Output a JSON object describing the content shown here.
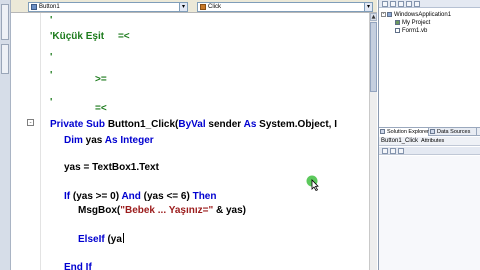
{
  "editor": {
    "class_combo": "Button1",
    "method_combo": "Click",
    "lines": {
      "comment1": "'",
      "comment2": "'Küçük Eşit     =<",
      "comment3": "'",
      "comment4a": "'",
      "comment4b": ">=",
      "comment5a": "'",
      "comment5b": "=<",
      "sub_decl": {
        "kw1": "Private Sub ",
        "name": "Button1_Click(",
        "kw2": "ByVal",
        "p1": " sender ",
        "kw3": "As",
        "p2": " System.Object, ",
        "tail": "I"
      },
      "dim": {
        "kw1": "Dim",
        "p1": " yas ",
        "kw2": "As Integer"
      },
      "assign": "yas = TextBox1.Text",
      "if": {
        "kw1": "If",
        "p1": " (yas >= 0) ",
        "kw2": "And",
        "p2": " (yas <= 6) ",
        "kw3": "Then"
      },
      "msgbox": {
        "p1": "MsgBox(",
        "str": "\"Bebek ... Yaşınız=\"",
        "p2": " & yas)"
      },
      "elseif": {
        "kw1": "ElseIf",
        "p1": " (ya"
      },
      "endif": {
        "kw1": "End If"
      }
    },
    "colors": {
      "keyword": "#0000d0",
      "comment": "#1b7a1b",
      "string": "#9b1b1b"
    }
  },
  "solution_explorer": {
    "root": "WindowsApplication1",
    "items": [
      "My Project",
      "Form1.vb"
    ],
    "tabs": [
      "Solution Explorer",
      "Data Sources"
    ]
  },
  "properties": {
    "object": "Button1_Click",
    "subtitle": "Attributes"
  }
}
